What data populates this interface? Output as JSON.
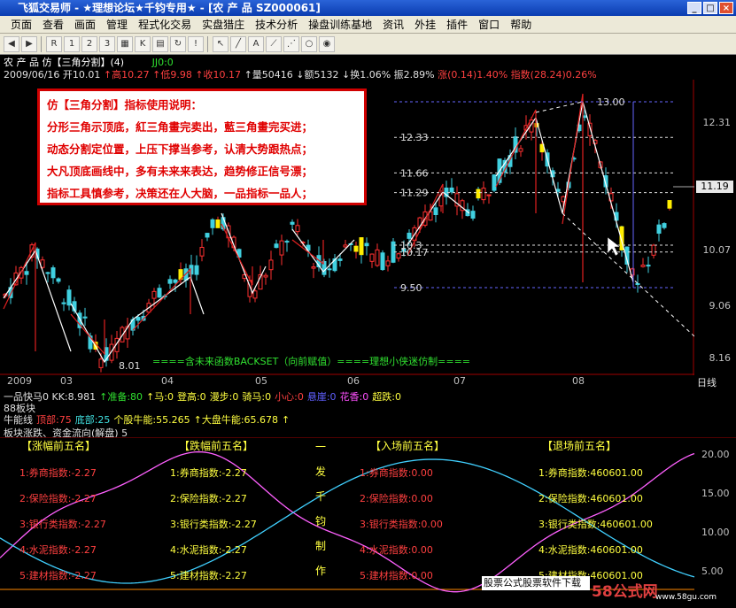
{
  "window": {
    "title": "飞狐交易师 - ★理想论坛★千钧专用★ - [农 产 品 SZ000061]",
    "controls": [
      "_",
      "□",
      "×"
    ]
  },
  "menu": [
    "页面",
    "查看",
    "画面",
    "管理",
    "程式化交易",
    "实盘猎庄",
    "技术分析",
    "操盘训练基地",
    "资讯",
    "外挂",
    "插件",
    "窗口",
    "帮助"
  ],
  "toolbar": {
    "items": [
      "back",
      "forward",
      "RSI",
      "1",
      "2",
      "3",
      "4",
      "5",
      "6",
      "7",
      "K",
      "grid",
      "line",
      "draw",
      "cursor",
      "text"
    ]
  },
  "stock_info": {
    "line1": "农 产 品 仿【三角分割】(4)",
    "jjo": "JJ0:0",
    "date": "2009/06/16",
    "open": "开10.01",
    "high": "↑高10.27",
    "low": "↑低9.98",
    "close": "↑收10.17",
    "vol": "↑量50416",
    "amt": "↓额5132",
    "turn": "↓换1.06%",
    "amp": "振2.89%",
    "chg": "涨(0.14)1.40%",
    "idx": "指数(28.24)0.26%"
  },
  "notice": {
    "title": "仿【三角分割】指标使用说明：",
    "lines": [
      "分形三角示顶底，紅三角畫完卖出，藍三角畫完买进；",
      "动态分割定位置，上压下撑当参考，认清大势跟热点；",
      "大凡顶底画线中，多有未来来表达，趋势修正信号漂；",
      "指标工具慎参考，决策还在人大脑，一品指标一品人；"
    ]
  },
  "chart_data": {
    "type": "candlestick",
    "price_ticks": [
      "12.31",
      "11.19",
      "10.07",
      "9.06",
      "8.16"
    ],
    "current_price": "11.19",
    "level_labels": [
      "13.00",
      "12.33",
      "11.66",
      "11.29",
      "10.3",
      "10.17",
      "9.50"
    ],
    "low_label": "8.01",
    "date_labels": [
      "2009",
      "03",
      "04",
      "05",
      "06",
      "07",
      "08"
    ],
    "day_label": "日线",
    "annotation": "====含未来函数BACKSET（向前赋值）====理想小侠迷仿制===="
  },
  "indicators": {
    "line1": [
      {
        "t": "一品快马0 KK:8.981",
        "c": "c-w"
      },
      {
        "t": "↑准备:80",
        "c": "c-g"
      },
      {
        "t": "↑马:0",
        "c": "c-y"
      },
      {
        "t": "登高:0",
        "c": "c-y"
      },
      {
        "t": "漫步:0",
        "c": "c-y"
      },
      {
        "t": "骑马:0",
        "c": "c-y"
      },
      {
        "t": "小心:0",
        "c": "c-r"
      },
      {
        "t": "悬崖:0",
        "c": "c-b"
      },
      {
        "t": "花香:0",
        "c": "c-m"
      },
      {
        "t": "超跌:0",
        "c": "c-y"
      }
    ],
    "block": "88板块",
    "line2": [
      {
        "t": "牛能线",
        "c": "c-w"
      },
      {
        "t": "顶部:75",
        "c": "c-r"
      },
      {
        "t": "底部:25",
        "c": "c-c"
      },
      {
        "t": "个股牛能:55.265",
        "c": "c-y"
      },
      {
        "t": "↑大盘牛能:65.678",
        "c": "c-y"
      },
      {
        "t": "↑",
        "c": "c-y"
      }
    ],
    "line3": "板块涨跌、资金流向(解盘) 5"
  },
  "bottom": {
    "headers": [
      "【涨幅前五名】",
      "【跌幅前五名】",
      "【入场前五名】",
      "【退场前五名】"
    ],
    "col1": [
      "1:券商指数:-2.27",
      "2:保险指数:-2.27",
      "3:银行类指数:-2.27",
      "4:水泥指数:-2.27",
      "5:建材指数:-2.27"
    ],
    "col2": [
      "1:券商指数:-2.27",
      "2:保险指数:-2.27",
      "3:银行类指数:-2.27",
      "4:水泥指数:-2.27",
      "5:建材指数:-2.27"
    ],
    "col3": [
      "1:券商指数:0.00",
      "2:保险指数:0.00",
      "3:银行类指数:0.00",
      "4:水泥指数:0.00",
      "5:建材指数:0.00"
    ],
    "col4": [
      "1:券商指数:460601.00",
      "2:保险指数:460601.00",
      "3:银行类指数:460601.00",
      "4:水泥指数:460601.00",
      "5:建材指数:460601.00"
    ],
    "vchars": [
      "一",
      "发",
      "千",
      "钧",
      "制",
      "作"
    ],
    "axis": [
      "20.00",
      "15.00",
      "10.00",
      "5.00"
    ]
  },
  "watermark": "股票公式股票软件下载",
  "logo": "58公式网",
  "logo_url": "www.58gu.com"
}
